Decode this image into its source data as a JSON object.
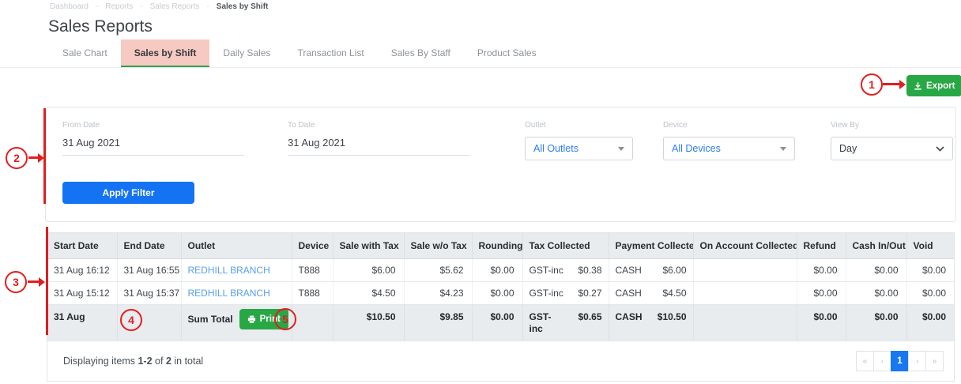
{
  "breadcrumb": {
    "items": [
      "Dashboard",
      "Reports",
      "Sales Reports"
    ],
    "separator": "-",
    "current": "Sales by Shift"
  },
  "page_title": "Sales Reports",
  "tabs": [
    {
      "label": "Sale Chart",
      "active": false
    },
    {
      "label": "Sales by Shift",
      "active": true
    },
    {
      "label": "Daily Sales",
      "active": false
    },
    {
      "label": "Transaction List",
      "active": false
    },
    {
      "label": "Sales By Staff",
      "active": false
    },
    {
      "label": "Product Sales",
      "active": false
    }
  ],
  "export_button": {
    "label": "Export"
  },
  "filters": {
    "from_date": {
      "label": "From Date",
      "value": "31 Aug 2021"
    },
    "to_date": {
      "label": "To Date",
      "value": "31 Aug 2021"
    },
    "outlet": {
      "label": "Outlet",
      "value": "All Outlets"
    },
    "device": {
      "label": "Device",
      "value": "All Devices"
    },
    "view_by": {
      "label": "View By",
      "value": "Day"
    },
    "apply_label": "Apply Filter"
  },
  "table": {
    "columns": [
      "Start Date",
      "End Date",
      "Outlet",
      "Device",
      "Sale with Tax",
      "Sale w/o Tax",
      "Rounding",
      "Tax Collected",
      "Payment Collected",
      "On Account Collected",
      "Refund",
      "Cash In/Out",
      "Void"
    ],
    "rows": [
      {
        "start_date": "31 Aug 16:12",
        "end_date": "31 Aug 16:55",
        "outlet": "REDHILL BRANCH",
        "device": "T888",
        "sale_with_tax": "$6.00",
        "sale_wo_tax": "$5.62",
        "rounding": "$0.00",
        "tax_label": "GST-inc",
        "tax_amount": "$0.38",
        "payment_label": "CASH",
        "payment_amount": "$6.00",
        "on_account": "",
        "refund": "$0.00",
        "cash_in_out": "$0.00",
        "void": "$0.00"
      },
      {
        "start_date": "31 Aug 15:12",
        "end_date": "31 Aug 15:37",
        "outlet": "REDHILL BRANCH",
        "device": "T888",
        "sale_with_tax": "$4.50",
        "sale_wo_tax": "$4.23",
        "rounding": "$0.00",
        "tax_label": "GST-inc",
        "tax_amount": "$0.27",
        "payment_label": "CASH",
        "payment_amount": "$4.50",
        "on_account": "",
        "refund": "$0.00",
        "cash_in_out": "$0.00",
        "void": "$0.00"
      }
    ],
    "sum_row": {
      "date": "31 Aug",
      "label": "Sum Total",
      "print_label": "Print",
      "sale_with_tax": "$10.50",
      "sale_wo_tax": "$9.85",
      "rounding": "$0.00",
      "tax_label": "GST-inc",
      "tax_amount": "$0.65",
      "payment_label": "CASH",
      "payment_amount": "$10.50",
      "on_account": "",
      "refund": "$0.00",
      "cash_in_out": "$0.00",
      "void": "$0.00"
    }
  },
  "footer": {
    "summary": {
      "prefix": "Displaying items ",
      "range": "1-2",
      "of": " of ",
      "total": "2",
      "suffix": " in total"
    },
    "pagination": {
      "first": "«",
      "prev": "‹",
      "page": "1",
      "next": "›",
      "last": "»"
    }
  },
  "annotations": {
    "n1": "1",
    "n2": "2",
    "n3": "3",
    "n4": "4",
    "n5": "5"
  },
  "icons": {
    "export": "download-icon",
    "print": "printer-icon",
    "outlet_dropdown": "chevron-down-icon",
    "device_dropdown": "chevron-down-icon",
    "view_by_select": "chevron-down-icon"
  },
  "colors": {
    "button_green": "#28a745",
    "button_blue": "#1473f2",
    "pagination_active_blue": "#1778f2",
    "link_blue": "#58a0f0",
    "dropdown_text_blue": "#2b7df0",
    "active_tab_highlight_pink": "#f7c9c3",
    "active_tab_underline_green": "#2fa44d",
    "annotation_red": "#e01e1e",
    "table_header_bg": "#e8ecef"
  }
}
